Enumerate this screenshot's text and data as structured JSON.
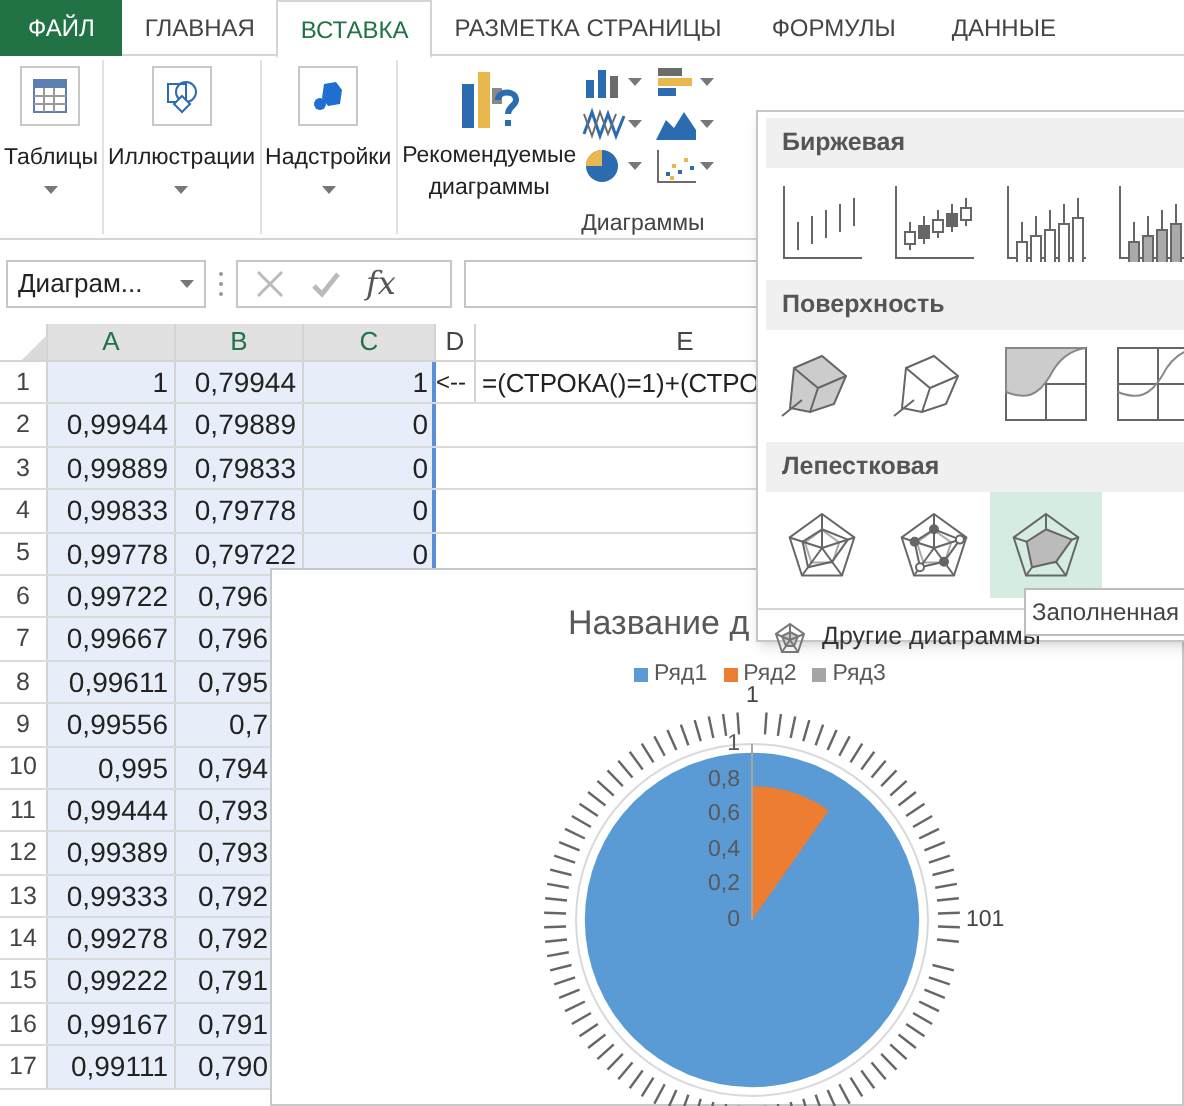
{
  "ribbon_tabs": [
    {
      "label": "ФАЙЛ",
      "kind": "file"
    },
    {
      "label": "ГЛАВНАЯ",
      "kind": "tab",
      "selected": false
    },
    {
      "label": "ВСТАВКА",
      "kind": "tab",
      "selected": true
    },
    {
      "label": "РАЗМЕТКА СТРАНИЦЫ",
      "kind": "tab",
      "selected": false
    },
    {
      "label": "ФОРМУЛЫ",
      "kind": "tab",
      "selected": false
    },
    {
      "label": "ДАННЫЕ",
      "kind": "tab",
      "selected": false
    }
  ],
  "ribbon_groups": [
    {
      "label": "Таблицы",
      "kind": "table"
    },
    {
      "label": "Иллюстрации",
      "kind": "shapes"
    },
    {
      "label": "Надстройки",
      "kind": "addin"
    }
  ],
  "recommended": {
    "label": "Рекомендуемые диаграммы"
  },
  "charts_group": {
    "label": "Диаграммы",
    "buttons": [
      {
        "kind": "column"
      },
      {
        "kind": "bar"
      },
      {
        "kind": "line"
      },
      {
        "kind": "area"
      },
      {
        "kind": "pie"
      },
      {
        "kind": "scatter"
      }
    ]
  },
  "name_box": {
    "value": "Диаграм..."
  },
  "formula_bar": {
    "fx": "fx"
  },
  "columns": [
    {
      "label": "A",
      "selected": true
    },
    {
      "label": "B",
      "selected": true
    },
    {
      "label": "C",
      "selected": true
    },
    {
      "label": "D",
      "selected": false
    },
    {
      "label": "E",
      "selected": false
    }
  ],
  "rows": [
    {
      "number": "1",
      "a": "1",
      "b": "0,79944",
      "c": "1",
      "d": "<--",
      "e": "=(СТРОКА()=1)+(СТРО",
      "covered": false
    },
    {
      "number": "2",
      "a": "0,99944",
      "b": "0,79889",
      "c": "0",
      "covered": false
    },
    {
      "number": "3",
      "a": "0,99889",
      "b": "0,79833",
      "c": "0",
      "covered": false
    },
    {
      "number": "4",
      "a": "0,99833",
      "b": "0,79778",
      "c": "0",
      "covered": false
    },
    {
      "number": "5",
      "a": "0,99778",
      "b": "0,79722",
      "c": "0",
      "covered": false
    },
    {
      "number": "6",
      "a": "0,99722",
      "b": "0,796",
      "covered": true
    },
    {
      "number": "7",
      "a": "0,99667",
      "b": "0,796",
      "covered": true
    },
    {
      "number": "8",
      "a": "0,99611",
      "b": "0,795",
      "covered": true
    },
    {
      "number": "9",
      "a": "0,99556",
      "b": "0,7",
      "covered": true
    },
    {
      "number": "10",
      "a": "0,995",
      "b": "0,794",
      "covered": true
    },
    {
      "number": "11",
      "a": "0,99444",
      "b": "0,793",
      "covered": true
    },
    {
      "number": "12",
      "a": "0,99389",
      "b": "0,793",
      "covered": true
    },
    {
      "number": "13",
      "a": "0,99333",
      "b": "0,792",
      "covered": true
    },
    {
      "number": "14",
      "a": "0,99278",
      "b": "0,792",
      "covered": true
    },
    {
      "number": "15",
      "a": "0,99222",
      "b": "0,791",
      "covered": true
    },
    {
      "number": "16",
      "a": "0,99167",
      "b": "0,791",
      "covered": true
    },
    {
      "number": "17",
      "a": "0,99111",
      "b": "0,790",
      "covered": true
    }
  ],
  "chart": {
    "title": "Название д",
    "legend": [
      {
        "name": "Ряд1",
        "color": "#5b9bd5"
      },
      {
        "name": "Ряд2",
        "color": "#ed7d31"
      },
      {
        "name": "Ряд3",
        "color": "#a5a5a5"
      }
    ],
    "axis_labels": [
      "1",
      "0,8",
      "0,6",
      "0,4",
      "0,2",
      "0"
    ],
    "category_labels": [
      {
        "label": "1",
        "kind": "top"
      },
      {
        "label": "101",
        "kind": "right"
      }
    ]
  },
  "gallery": {
    "sections": [
      {
        "title": "Биржевая",
        "kind": "stock",
        "items": [
          {
            "selected": false
          },
          {
            "selected": false
          },
          {
            "selected": false
          },
          {
            "selected": false
          }
        ]
      },
      {
        "title": "Поверхность",
        "kind": "surface",
        "items": [
          {
            "selected": false
          },
          {
            "selected": false
          },
          {
            "selected": false
          },
          {
            "selected": false
          }
        ]
      },
      {
        "title": "Лепестковая",
        "kind": "radar",
        "items": [
          {
            "selected": false
          },
          {
            "selected": false
          },
          {
            "selected": true
          }
        ]
      }
    ],
    "more": "Другие диаграммы"
  },
  "tooltip": "Заполненная"
}
